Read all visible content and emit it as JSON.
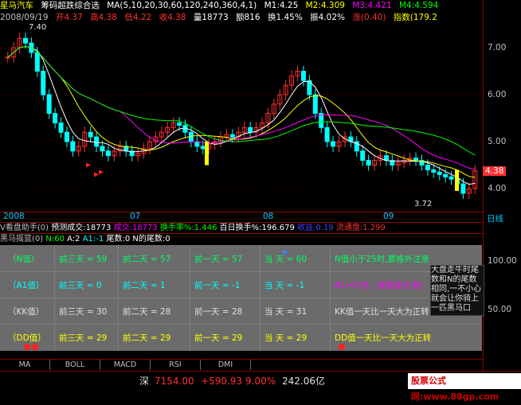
{
  "header": {
    "stock_name": "星马汽车",
    "indicator_title": "筹码超跌综合选",
    "ma_label": "MA(5,10,20,30,60,120,240,360,4,1)",
    "m1": "M1:4.25",
    "m2": "M2:4.309",
    "m3": "M3:4.421",
    "m4": "M4:4.594",
    "date": "2008/09/19",
    "open": "开4.37",
    "high": "高4.38",
    "low": "低4.22",
    "close": "收4.38",
    "volume": "量18773",
    "amount": "额816",
    "turnover": "换1.45%",
    "amplitude": "振4.02%",
    "change": "涨(0.40)",
    "index": "指数(179.2"
  },
  "price_axis": {
    "labels": [
      "7.00",
      "6.00",
      "5.00",
      "4.38",
      "4.00"
    ],
    "high_mark": "7.40",
    "low_mark": "3.72"
  },
  "date_axis": {
    "labels": [
      "2008",
      "07",
      "08",
      "09"
    ],
    "period": "日线"
  },
  "volume_bar": {
    "text1": "V看盘助手(0)",
    "text2": "预测成交:18773",
    "text3": "成交:18773",
    "text4": "换手率%:1.446",
    "text5": "百日换手%:196.679",
    "text6": "收益:0.19",
    "text7": "流通盘:1.299"
  },
  "panel": {
    "title": "黑马摇篮(0)",
    "n": "N:60",
    "a": "A:2",
    "a1": "A1:-1",
    "tail": "尾数:0",
    "ntail": "N的尾数:0",
    "axis": [
      "100.00",
      "50.00"
    ]
  },
  "table": {
    "rows": [
      {
        "label": "（N值）",
        "c1": "前三天 = 59",
        "c2": "前二天 = 57",
        "c3": "前一天 = 57",
        "c4": "当   天 = 60",
        "note": "N值小于25时,要格外注意",
        "color": "#00ff66"
      },
      {
        "label": "（A1值）",
        "c1": "前三天 = 0",
        "c2": "前二天 = 1",
        "c3": "前一天 = -1",
        "c4": "当   天 = -1",
        "note": "A1=0 时，很容易大涨！",
        "color": "#00ffff"
      },
      {
        "label": "（KK值）",
        "c1": "前三天 = 30",
        "c2": "前二天 = 28",
        "c3": "前一天 = 28",
        "c4": "当   天 = 31",
        "note": "KK值一天比一天大为正转",
        "color": "#e0e0e0"
      },
      {
        "label": "（DD值）",
        "c1": "前三天 = 29",
        "c2": "前二天 = 29",
        "c3": "前一天 = 29",
        "c4": "当   天 = 29",
        "note": "DD值一天比一天大为正转",
        "color": "#ffff00"
      }
    ]
  },
  "tooltip": "大盘走牛时尾数和N的尾数相同,一不小心就会让你骑上一匹黑马口",
  "tabs": [
    "MA",
    "BOLL",
    "MACD",
    "RSI",
    "DMI"
  ],
  "status": {
    "market": "深",
    "index": "7154.00",
    "change": "+590.93",
    "percent": "9.00%",
    "amount": "242.06亿",
    "site": "股票公式网:www.88gp.com"
  },
  "colors": {
    "up": "#ff3030",
    "down": "#00ffff",
    "ma5": "#ffffff",
    "ma10": "#ffff00",
    "ma20": "#ff00ff",
    "ma30": "#00ff00"
  }
}
